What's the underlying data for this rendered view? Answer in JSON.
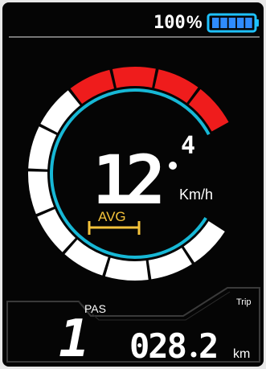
{
  "status": {
    "battery_percent_text": "100",
    "percent_sign": "%",
    "battery_bars_filled": 5,
    "battery_bars_total": 5
  },
  "speed": {
    "main": "12",
    "decimal": "4",
    "unit": "Km/h",
    "avg_label": "AVG"
  },
  "gauge": {
    "segments_total": 12,
    "segments_red": 4
  },
  "assist": {
    "label": "PAS",
    "level": "1"
  },
  "trip": {
    "label": "Trip",
    "distance_int": "028",
    "distance_dec": "2",
    "unit": "km"
  },
  "colors": {
    "accent_cyan": "#17b8d6",
    "red": "#ef1c1c",
    "white": "#ffffff",
    "avg_yellow": "#f5c33b",
    "battery_blue": "#2f8cff",
    "battery_outline": "#1ec1ff",
    "panel_gray": "#2a2a2a"
  },
  "icons": {
    "battery": "battery-icon"
  }
}
